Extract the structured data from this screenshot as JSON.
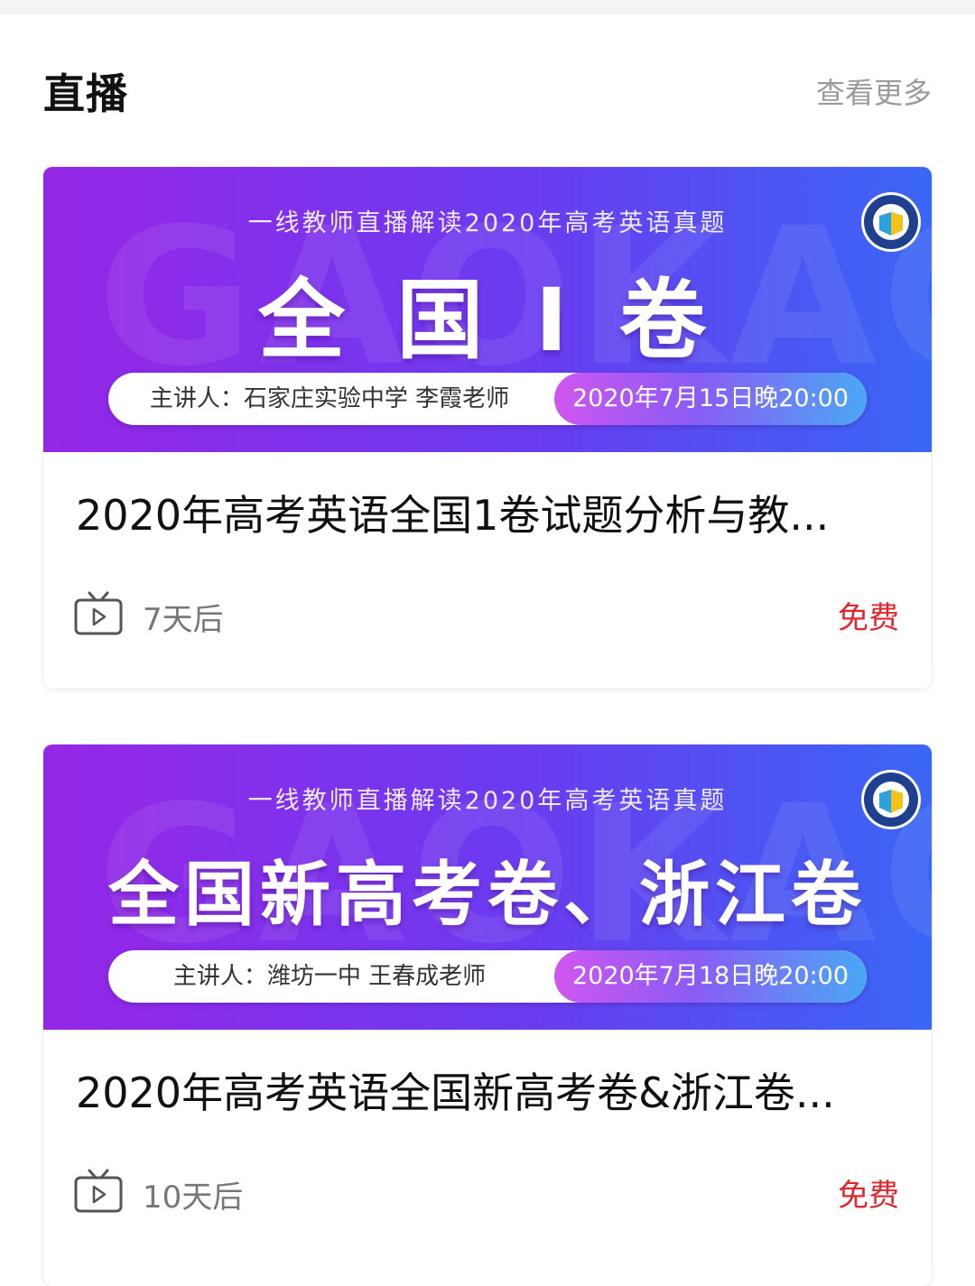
{
  "header": {
    "title": "直播",
    "see_more": "查看更多"
  },
  "colors": {
    "accent_red": "#e0272e",
    "banner_start": "#9626e6",
    "banner_end": "#3a66f5"
  },
  "cards": [
    {
      "banner_watermark": "GAOKAO",
      "banner_subtitle": "一线教师直播解读2020年高考英语真题",
      "banner_title": "全 国 I 卷",
      "speaker": "主讲人：石家庄实验中学 李霞老师",
      "date": "2020年7月15日晚20:00",
      "title": "2020年高考英语全国1卷试题分析与教...",
      "time_until": "7天后",
      "price": "免费",
      "icon": "tv-play-icon"
    },
    {
      "banner_watermark": "GAOKAO",
      "banner_subtitle": "一线教师直播解读2020年高考英语真题",
      "banner_title": "全国新高考卷、浙江卷",
      "speaker": "主讲人：潍坊一中 王春成老师",
      "date": "2020年7月18日晚20:00",
      "title": "2020年高考英语全国新高考卷&浙江卷...",
      "time_until": "10天后",
      "price": "免费",
      "icon": "tv-play-icon"
    }
  ]
}
